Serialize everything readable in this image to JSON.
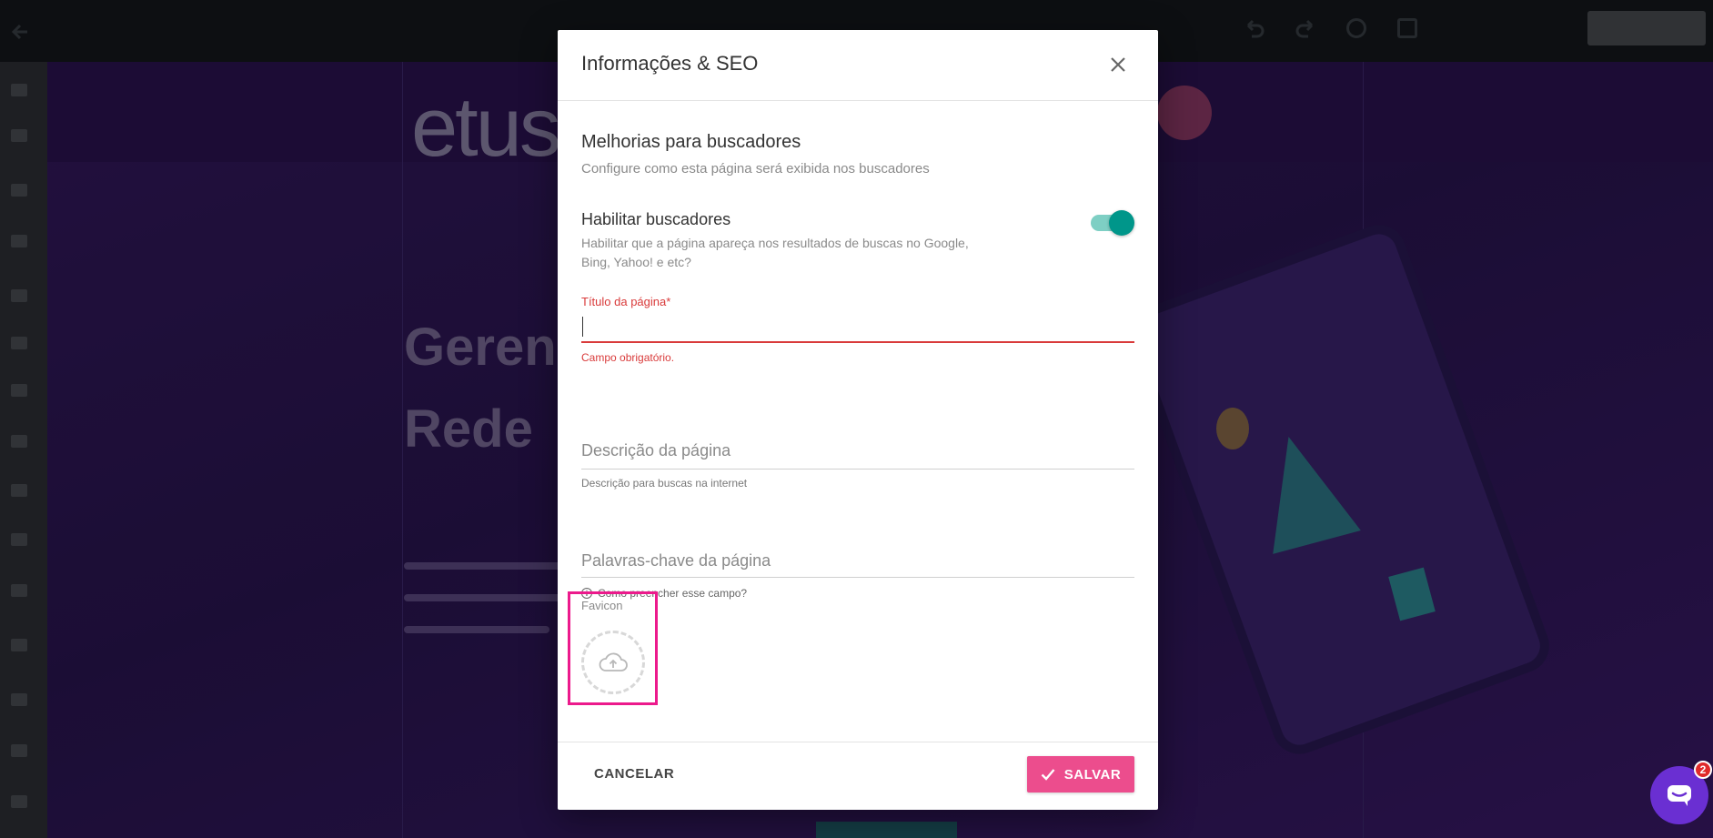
{
  "modal": {
    "title": "Informações & SEO",
    "section_title": "Melhorias para buscadores",
    "section_subtitle": "Configure como esta página será exibida nos buscadores",
    "toggle_label": "Habilitar buscadores",
    "toggle_description": "Habilitar que a página apareça nos resultados de buscas no Google, Bing, Yahoo! e etc?",
    "toggle_on": true,
    "title_field_label": "Título da página*",
    "title_field_value": "",
    "title_field_error": "Campo obrigatório.",
    "description_placeholder": "Descrição da página",
    "description_hint": "Descrição para buscas na internet",
    "keywords_placeholder": "Palavras-chave da página",
    "keywords_help": "Como preencher esse campo?",
    "favicon_label": "Favicon",
    "cancel_label": "CANCELAR",
    "save_label": "SALVAR"
  },
  "chat_widget": {
    "badge_count": "2"
  },
  "colors": {
    "primary_pink": "#ec4d8d",
    "highlight_pink": "#ec1a8c",
    "toggle_teal": "#00968a",
    "error_red": "#d93a3a",
    "chat_purple": "#6a2fd2"
  }
}
